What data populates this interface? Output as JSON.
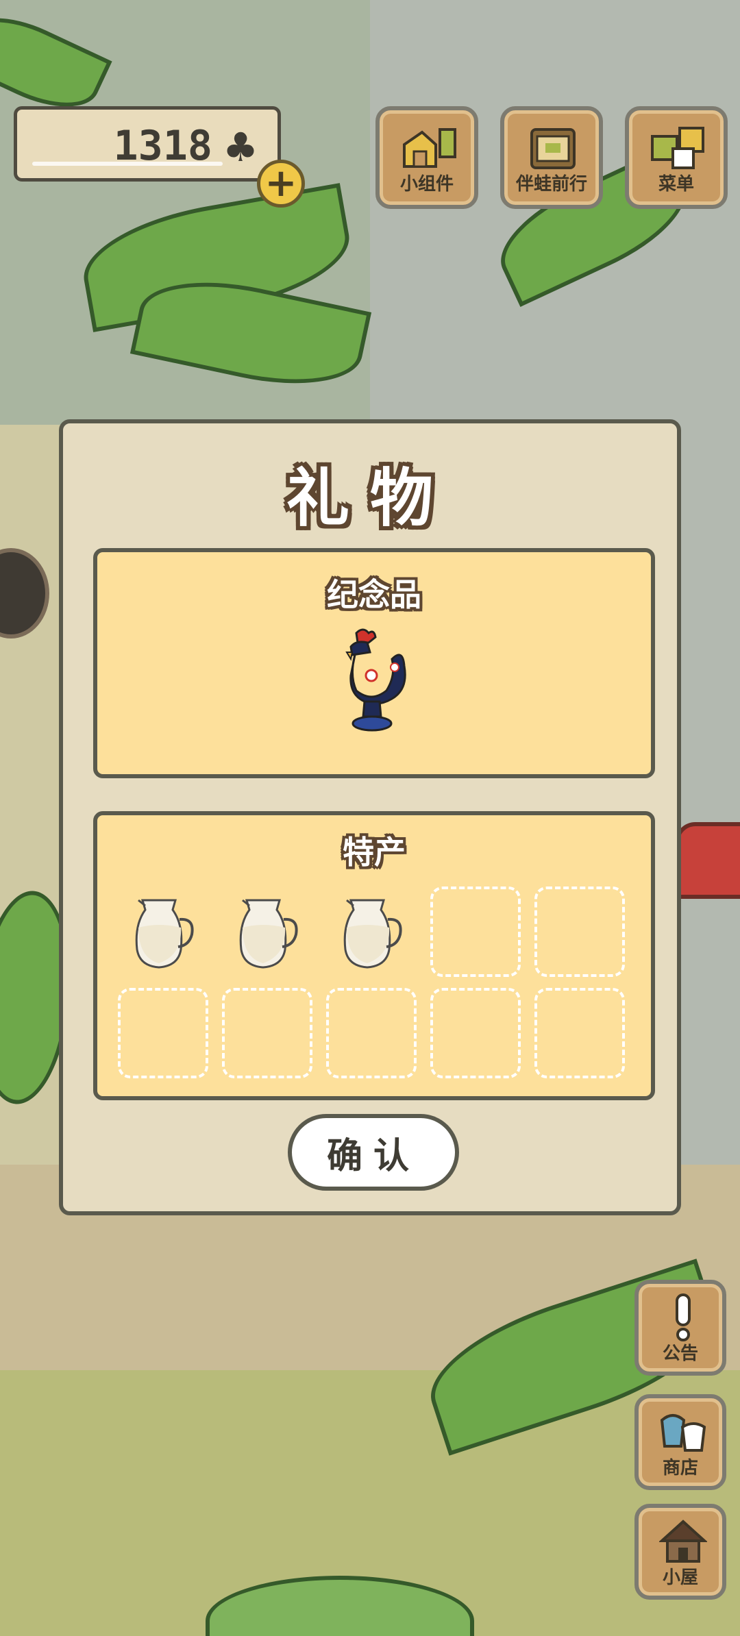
{
  "hud": {
    "clover_count": "1318",
    "clover_icon": "clover-icon",
    "buttons": [
      {
        "label": "小组件",
        "icon": "widget-icon"
      },
      {
        "label": "伴蛙前行",
        "icon": "journey-book-icon"
      },
      {
        "label": "菜单",
        "icon": "menu-cards-icon"
      }
    ]
  },
  "side_buttons": [
    {
      "label": "公告",
      "icon": "exclamation-icon"
    },
    {
      "label": "商店",
      "icon": "shop-bags-icon"
    },
    {
      "label": "小屋",
      "icon": "house-icon"
    }
  ],
  "dialog": {
    "title": "礼物",
    "souvenir": {
      "title": "纪念品",
      "item": "rooster-figurine"
    },
    "specialty": {
      "title": "特产",
      "filled_count": 3,
      "total_slots": 10,
      "item": "milk-jug"
    },
    "confirm_label": "确认"
  },
  "colors": {
    "panel_fill": "#fde09b",
    "dialog_fill": "#e6dcc1",
    "outline": "#5a5a4d",
    "button_wood": "#c89b63"
  }
}
